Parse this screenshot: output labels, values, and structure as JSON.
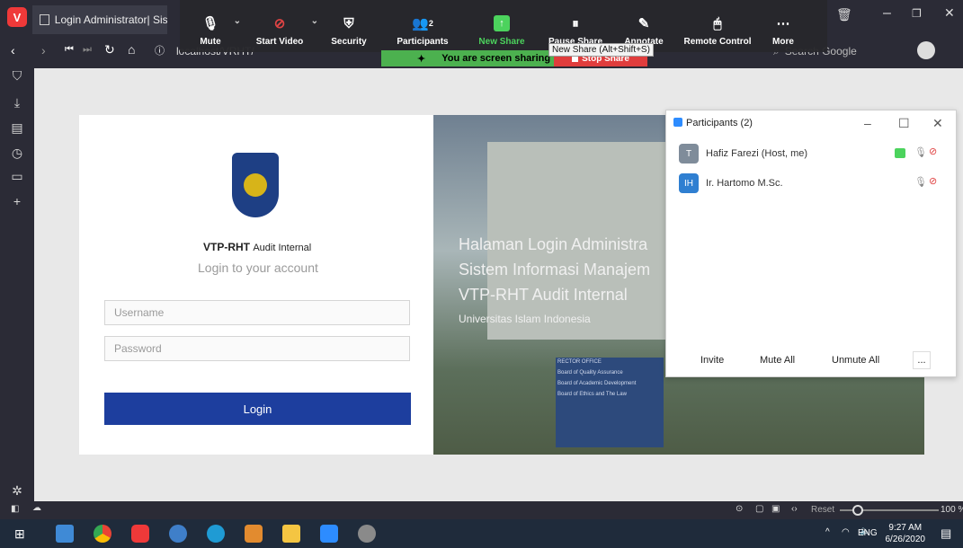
{
  "browser": {
    "tab_title": "Login Administrator| Sisten",
    "address": "localhost/VRHT/",
    "search_placeholder": "Search Google",
    "zoom_label": "Reset",
    "zoom_value": "100 %"
  },
  "zoom_toolbar": {
    "buttons": [
      {
        "label": "Mute"
      },
      {
        "label": "Start Video"
      },
      {
        "label": "Security"
      },
      {
        "label": "Participants",
        "count": "2"
      },
      {
        "label": "New Share"
      },
      {
        "label": "Pause Share"
      },
      {
        "label": "Annotate"
      },
      {
        "label": "Remote Control"
      },
      {
        "label": "More"
      }
    ],
    "tooltip": "New Share (Alt+Shift+S)",
    "sharing_banner": "You are screen sharing",
    "stop_share": "Stop Share"
  },
  "login": {
    "app_name": "VTP-RHT",
    "app_suffix": "Audit Internal",
    "subtitle": "Login to your account",
    "username_placeholder": "Username",
    "password_placeholder": "Password",
    "login_button": "Login"
  },
  "photo_text": {
    "line1": "Halaman Login Administra",
    "line2": "Sistem Informasi Manajem",
    "line3": "VTP-RHT Audit Internal",
    "line4": "Universitas Islam Indonesia",
    "sign1": "RECTOR OFFICE",
    "sign2": "Board of Quality Assurance",
    "sign3": "Board of Academic Development",
    "sign4": "Board of Ethics and The Law"
  },
  "participants": {
    "title": "Participants (2)",
    "list": [
      {
        "initial": "T",
        "name": "Hafiz Farezi (Host, me)",
        "color": "#7f8c9a"
      },
      {
        "initial": "IH",
        "name": "Ir. Hartomo M.Sc.",
        "color": "#2f7fd1"
      }
    ],
    "invite": "Invite",
    "mute_all": "Mute All",
    "unmute_all": "Unmute All",
    "more": "..."
  },
  "taskbar": {
    "time": "9:27 AM",
    "date": "6/26/2020",
    "lang": "ENG"
  },
  "colors": {
    "zoom_green": "#4cb14f",
    "stop_red": "#e03d3d",
    "login_blue": "#1d3e9e"
  }
}
